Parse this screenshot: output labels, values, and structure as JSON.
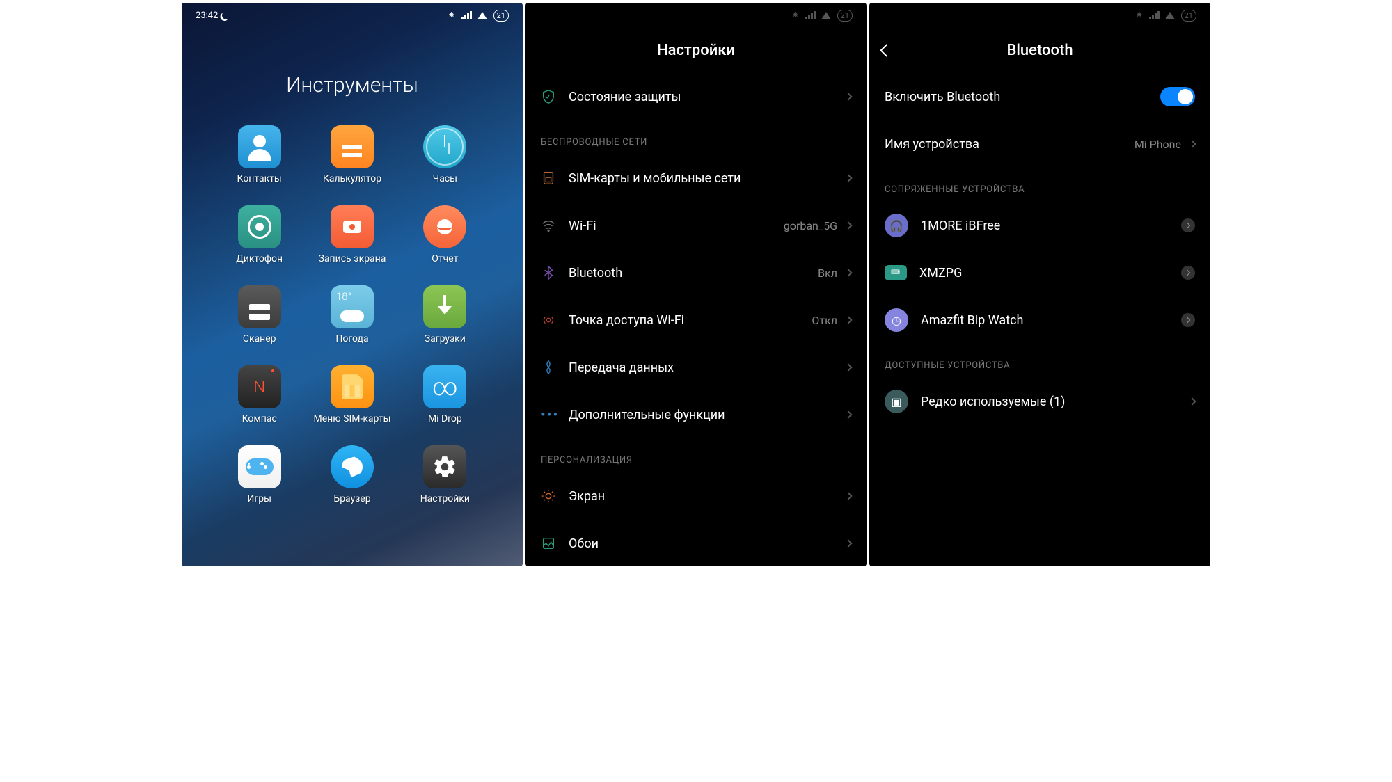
{
  "status": {
    "time": "23:42",
    "battery": "21"
  },
  "screen1": {
    "title": "Инструменты",
    "weather_temp": "18°",
    "apps": [
      {
        "label": "Контакты"
      },
      {
        "label": "Калькулятор"
      },
      {
        "label": "Часы"
      },
      {
        "label": "Диктофон"
      },
      {
        "label": "Запись\nэкрана"
      },
      {
        "label": "Отчет"
      },
      {
        "label": "Сканер"
      },
      {
        "label": "Погода"
      },
      {
        "label": "Загрузки"
      },
      {
        "label": "Компас"
      },
      {
        "label": "Меню\nSIM-карты"
      },
      {
        "label": "Mi Drop"
      },
      {
        "label": "Игры"
      },
      {
        "label": "Браузер"
      },
      {
        "label": "Настройки"
      }
    ]
  },
  "screen2": {
    "title": "Настройки",
    "security": "Состояние защиты",
    "sect_wireless": "БЕСПРОВОДНЫЕ СЕТИ",
    "sim": "SIM-карты и мобильные сети",
    "wifi": "Wi-Fi",
    "wifi_val": "gorban_5G",
    "bt": "Bluetooth",
    "bt_val": "Вкл",
    "hotspot": "Точка доступа Wi-Fi",
    "hotspot_val": "Откл",
    "data": "Передача данных",
    "more": "Дополнительные функции",
    "sect_personal": "ПЕРСОНАЛИЗАЦИЯ",
    "display": "Экран",
    "wallpaper": "Обои"
  },
  "screen3": {
    "title": "Bluetooth",
    "enable": "Включить Bluetooth",
    "device_name": "Имя устройства",
    "device_val": "Mi Phone",
    "sect_paired": "СОПРЯЖЕННЫЕ УСТРОЙСТВА",
    "dev1": "1MORE iBFree",
    "dev2": "XMZPG",
    "dev3": "Amazfit Bip Watch",
    "sect_avail": "ДОСТУПНЫЕ УСТРОЙСТВА",
    "rare": "Редко используемые (1)"
  }
}
